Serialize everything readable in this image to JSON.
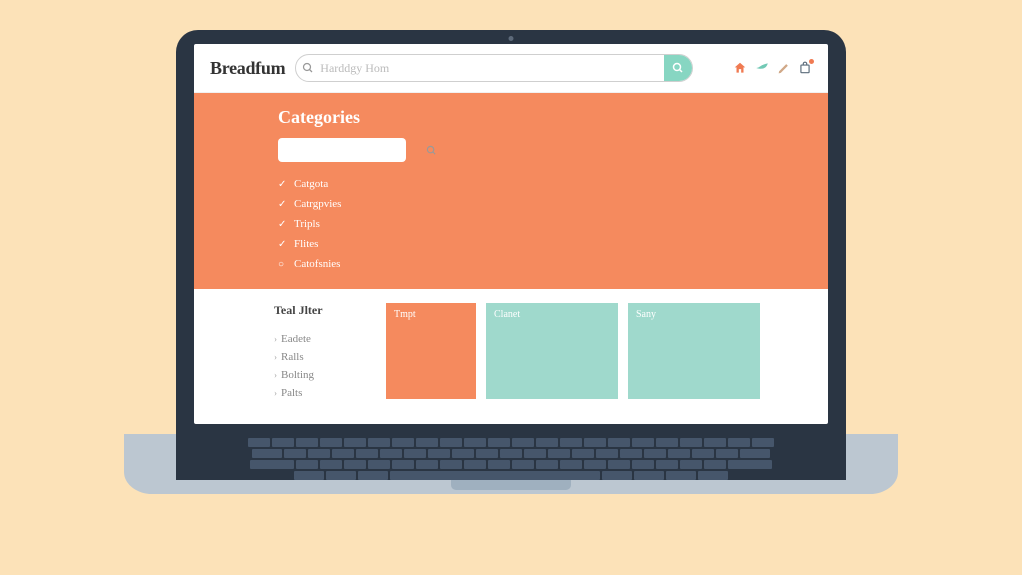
{
  "header": {
    "brand": "Breadfum",
    "search_placeholder": "Harddgy Hom",
    "search_value": ""
  },
  "orange": {
    "title": "Categories",
    "mini_search_value": "",
    "items": [
      {
        "label": "Catgota",
        "checked": true
      },
      {
        "label": "Catrgpvies",
        "checked": true
      },
      {
        "label": "Tripls",
        "checked": true
      },
      {
        "label": "Flites",
        "checked": true
      },
      {
        "label": "Catofsnies",
        "checked": false
      }
    ]
  },
  "filter": {
    "title": "Teal Jlter",
    "items": [
      "Eadete",
      "Ralls",
      "Bolting",
      "Palts"
    ]
  },
  "cards": [
    {
      "label": "Tmpt",
      "variant": "orange",
      "width": "normal"
    },
    {
      "label": "Clanet",
      "variant": "teal",
      "width": "wide"
    },
    {
      "label": "Sany",
      "variant": "teal",
      "width": "wide"
    }
  ]
}
